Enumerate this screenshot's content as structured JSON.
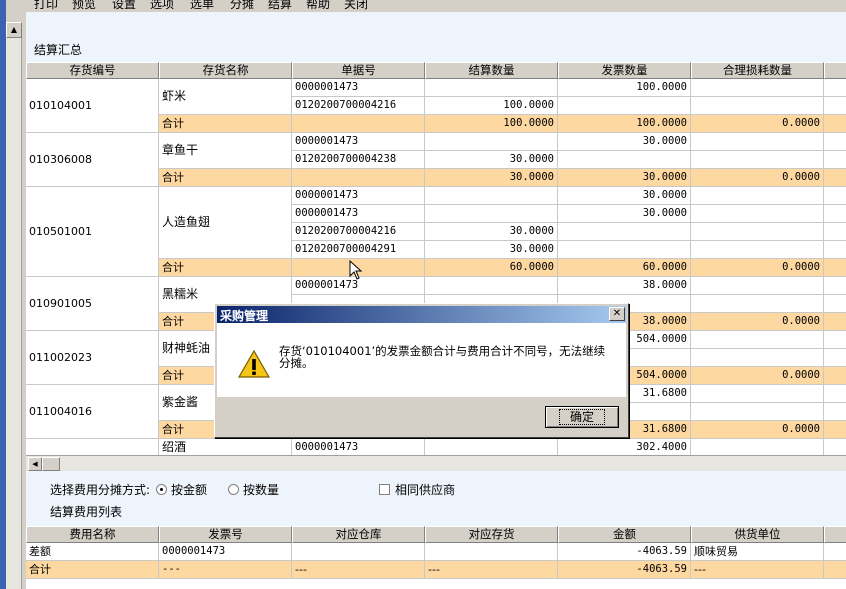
{
  "menu": [
    "打印",
    "预览",
    "设置",
    "选项",
    "选单",
    "分摊",
    "结算",
    "帮助",
    "关闭"
  ],
  "summary": {
    "title": "结算汇总",
    "columns": [
      "存货编号",
      "存货名称",
      "单据号",
      "结算数量",
      "发票数量",
      "合理损耗数量"
    ],
    "rows": [
      {
        "code": "",
        "name": "",
        "doc": "0000001473",
        "settle_qty": "",
        "invoice_qty": "100.0000",
        "loss_qty": "",
        "sum": false
      },
      {
        "code": "",
        "name": "",
        "doc": "0120200700004216",
        "settle_qty": "100.0000",
        "invoice_qty": "",
        "loss_qty": "",
        "sum": false
      },
      {
        "code": "",
        "name": "合计",
        "doc": "",
        "settle_qty": "100.0000",
        "invoice_qty": "100.0000",
        "loss_qty": "0.0000",
        "sum": true
      },
      {
        "code": "",
        "name": "",
        "doc": "0000001473",
        "settle_qty": "",
        "invoice_qty": "30.0000",
        "loss_qty": "",
        "sum": false
      },
      {
        "code": "",
        "name": "",
        "doc": "0120200700004238",
        "settle_qty": "30.0000",
        "invoice_qty": "",
        "loss_qty": "",
        "sum": false
      },
      {
        "code": "",
        "name": "合计",
        "doc": "",
        "settle_qty": "30.0000",
        "invoice_qty": "30.0000",
        "loss_qty": "0.0000",
        "sum": true
      },
      {
        "code": "",
        "name": "",
        "doc": "0000001473",
        "settle_qty": "",
        "invoice_qty": "30.0000",
        "loss_qty": "",
        "sum": false
      },
      {
        "code": "",
        "name": "",
        "doc": "0000001473",
        "settle_qty": "",
        "invoice_qty": "30.0000",
        "loss_qty": "",
        "sum": false
      },
      {
        "code": "",
        "name": "",
        "doc": "0120200700004216",
        "settle_qty": "30.0000",
        "invoice_qty": "",
        "loss_qty": "",
        "sum": false
      },
      {
        "code": "",
        "name": "",
        "doc": "0120200700004291",
        "settle_qty": "30.0000",
        "invoice_qty": "",
        "loss_qty": "",
        "sum": false
      },
      {
        "code": "",
        "name": "合计",
        "doc": "",
        "settle_qty": "60.0000",
        "invoice_qty": "60.0000",
        "loss_qty": "0.0000",
        "sum": true
      },
      {
        "code": "",
        "name": "",
        "doc": "0000001473",
        "settle_qty": "",
        "invoice_qty": "38.0000",
        "loss_qty": "",
        "sum": false
      },
      {
        "code": "",
        "name": "",
        "doc": "",
        "settle_qty": "",
        "invoice_qty": "",
        "loss_qty": "",
        "sum": false
      },
      {
        "code": "",
        "name": "合计",
        "doc": "",
        "settle_qty": "",
        "invoice_qty": "38.0000",
        "loss_qty": "0.0000",
        "sum": true
      },
      {
        "code": "",
        "name": "",
        "doc": "",
        "settle_qty": "",
        "invoice_qty": "504.0000",
        "loss_qty": "",
        "sum": false
      },
      {
        "code": "",
        "name": "",
        "doc": "",
        "settle_qty": "",
        "invoice_qty": "",
        "loss_qty": "",
        "sum": false
      },
      {
        "code": "",
        "name": "合计",
        "doc": "",
        "settle_qty": "",
        "invoice_qty": "504.0000",
        "loss_qty": "0.0000",
        "sum": true
      },
      {
        "code": "",
        "name": "",
        "doc": "",
        "settle_qty": "",
        "invoice_qty": "31.6800",
        "loss_qty": "",
        "sum": false
      },
      {
        "code": "",
        "name": "",
        "doc": "",
        "settle_qty": "",
        "invoice_qty": "",
        "loss_qty": "",
        "sum": false
      },
      {
        "code": "",
        "name": "合计",
        "doc": "",
        "settle_qty": "",
        "invoice_qty": "31.6800",
        "loss_qty": "0.0000",
        "sum": true
      },
      {
        "code": "",
        "name": "",
        "doc": "0000001473",
        "settle_qty": "",
        "invoice_qty": "302.4000",
        "loss_qty": "",
        "sum": false
      }
    ],
    "groups": [
      {
        "code": "010104001",
        "name": "虾米",
        "detail_rows": 2
      },
      {
        "code": "010306008",
        "name": "章鱼干",
        "detail_rows": 2
      },
      {
        "code": "010501001",
        "name": "人造鱼翅",
        "detail_rows": 4
      },
      {
        "code": "010901005",
        "name": "黑糯米",
        "detail_rows": 2
      },
      {
        "code": "011002023",
        "name": "财神蚝油",
        "detail_rows": 2
      },
      {
        "code": "011004016",
        "name": "紫金酱",
        "detail_rows": 2
      },
      {
        "code": "",
        "name": "绍酒",
        "detail_rows": 1
      }
    ]
  },
  "options": {
    "method_label": "选择费用分摊方式:",
    "by_amount": "按金额",
    "by_quantity": "按数量",
    "same_supplier": "相同供应商",
    "selected": "by_amount"
  },
  "fees": {
    "title": "结算费用列表",
    "columns": [
      "费用名称",
      "发票号",
      "对应仓库",
      "对应存货",
      "金额",
      "供货单位"
    ],
    "rows": [
      {
        "name": "差额",
        "invoice": "0000001473",
        "warehouse": "",
        "item": "",
        "amount": "-4063.59",
        "supplier": "顺味贸易",
        "sum": false
      },
      {
        "name": "合计",
        "invoice": "---",
        "warehouse": "---",
        "item": "---",
        "amount": "-4063.59",
        "supplier": "---",
        "sum": true
      }
    ]
  },
  "dialog": {
    "title": "采购管理",
    "message": "存货‘010104001’的发票金额合计与费用合计不同号，无法继续分摊。",
    "ok_label": "确定",
    "close_glyph": "✕"
  },
  "icons": {
    "warning": "warning-icon",
    "up": "▲",
    "left": "◀"
  },
  "colors": {
    "sum_row": "#fdd8a0",
    "title_bar": "#0a246a",
    "panel_bg": "#eef4fb",
    "warning": "#f5c518"
  }
}
